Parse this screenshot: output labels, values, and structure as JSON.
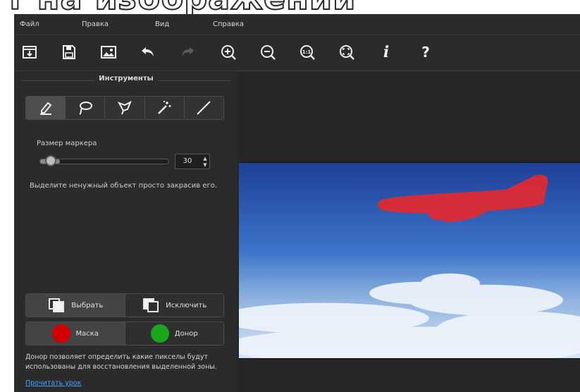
{
  "headline": "т на изображении",
  "menu": [
    "Файл",
    "Правка",
    "Вид",
    "Справка"
  ],
  "toolbar_icons": [
    "open-icon",
    "save-icon",
    "image-icon",
    "undo-icon",
    "redo-icon",
    "zoom-in-icon",
    "zoom-out-icon",
    "zoom-actual-icon",
    "zoom-fit-icon",
    "info-icon",
    "help-icon"
  ],
  "toolbar_glyphs": {
    "actual": "1:1",
    "info": "i",
    "help": "?"
  },
  "panel": {
    "title": "Инструменты",
    "tools": [
      "marker-icon",
      "lasso-icon",
      "polygon-lasso-icon",
      "magic-wand-icon",
      "line-icon"
    ],
    "marker_size_label": "Размер маркера",
    "marker_size": 30,
    "marker_size_max": 100,
    "hint": "Выделите ненужный объект просто закрасив его.",
    "select_label": "Выбрать",
    "exclude_label": "Исключить",
    "mask_label": "Маска",
    "donor_label": "Донор",
    "mask_color": "#d40000",
    "donor_color": "#1aa51a",
    "donor_note": "Донор позволяет определить какие пикселы будут использованы для восстановления выделенной зоны.",
    "lesson_link": "Прочитать урок"
  },
  "colors": {
    "background": "#2b2b2b",
    "selection_overlay": "#e8282e",
    "sky_top": "#1f3f97",
    "sky_bottom": "#d8e6f4"
  }
}
